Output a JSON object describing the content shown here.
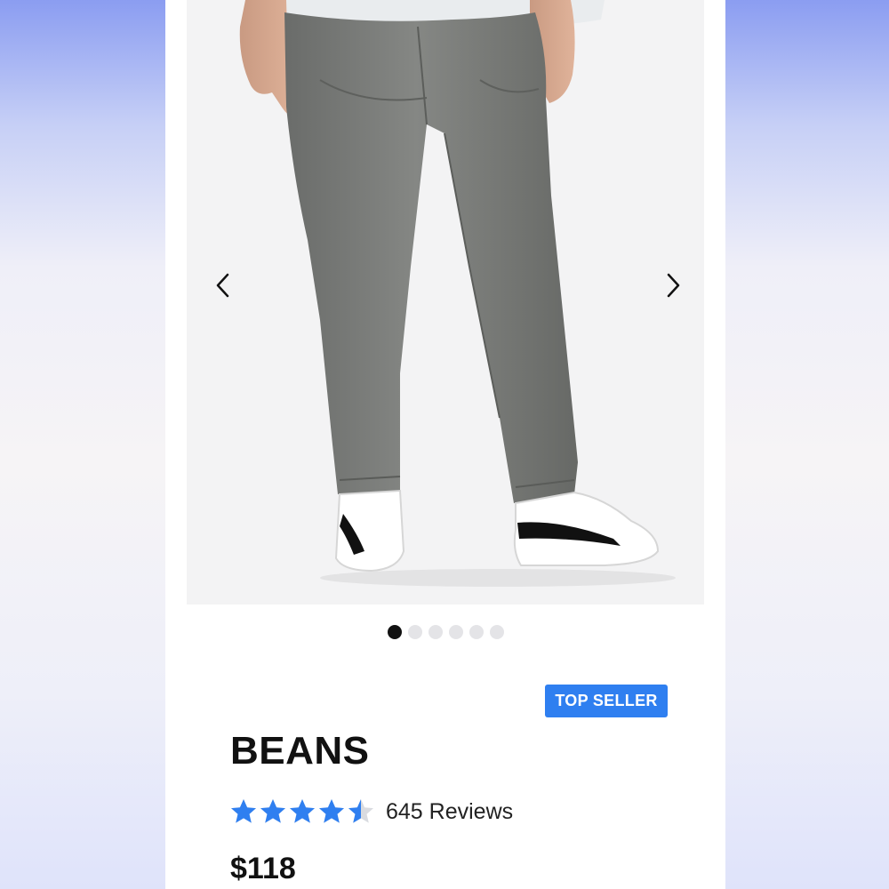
{
  "product": {
    "badge": "TOP SELLER",
    "name": "BEANS",
    "rating": 4.5,
    "rating_max": 5,
    "reviews_label": "645 Reviews",
    "price": "$118"
  },
  "gallery": {
    "image_count": 6,
    "active_index": 0
  },
  "colors": {
    "badge_bg": "#2f7ff0",
    "star_fill": "#2f7ff0",
    "dot_active": "#111111",
    "dot_inactive": "#e4e4e7"
  },
  "icons": {
    "prev": "chevron-left-icon",
    "next": "chevron-right-icon",
    "star": "star-icon"
  }
}
